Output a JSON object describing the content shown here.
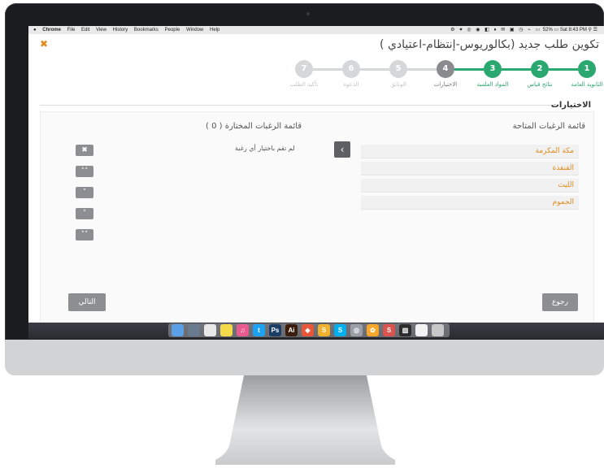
{
  "menubar": {
    "items": [
      "Chrome",
      "File",
      "Edit",
      "View",
      "History",
      "Bookmarks",
      "People",
      "Window",
      "Help"
    ],
    "battery": "52%",
    "clock": "Sat 8:43 PM"
  },
  "page": {
    "title": "تكوين طلب جديد (بكالوريوس-إنتظام-اعتيادي )",
    "steps": [
      {
        "number": "1",
        "label": "الثانوية العامة",
        "state": "done"
      },
      {
        "number": "2",
        "label": "نتائج قياس",
        "state": "done"
      },
      {
        "number": "3",
        "label": "المواد العلمية",
        "state": "done"
      },
      {
        "number": "4",
        "label": "الاختيارات",
        "state": "current"
      },
      {
        "number": "5",
        "label": "الوثائق",
        "state": "pending"
      },
      {
        "number": "6",
        "label": "الدعوة",
        "state": "pending"
      },
      {
        "number": "7",
        "label": "تأكيد الطلب",
        "state": "pending"
      }
    ],
    "section_title": "الاختيارات",
    "available_title": "قائمة الرغبات المتاحة",
    "selected_title": "قائمة الرغبات المختارة ( 0 )",
    "available_items": [
      "مكة المكرمة",
      "القنفذة",
      "الليث",
      "الجموم"
    ],
    "empty_message": "لم تقم باختيار أي رغبة",
    "add_icon": "‹",
    "controls": [
      {
        "name": "remove-button",
        "icon": "✖"
      },
      {
        "name": "move-top-button",
        "icon": "˄˄"
      },
      {
        "name": "move-up-button",
        "icon": "˄"
      },
      {
        "name": "move-down-button",
        "icon": "˅"
      },
      {
        "name": "move-bottom-button",
        "icon": "˅˅"
      }
    ],
    "next_label": "التالي",
    "back_label": "رجوع"
  },
  "colors": {
    "accent_green": "#2aa86f",
    "current_gray": "#8a8b8e",
    "pending_gray": "#d6d7d9",
    "link_orange": "#e08a1e"
  },
  "dock": [
    "finder",
    "launchpad",
    "chrome",
    "notes",
    "itunes",
    "twitter",
    "photoshop",
    "illustrator",
    "viz",
    "sketch",
    "skype",
    "pinwheel",
    "photos",
    "skitch",
    "activity",
    "document",
    "trash"
  ]
}
